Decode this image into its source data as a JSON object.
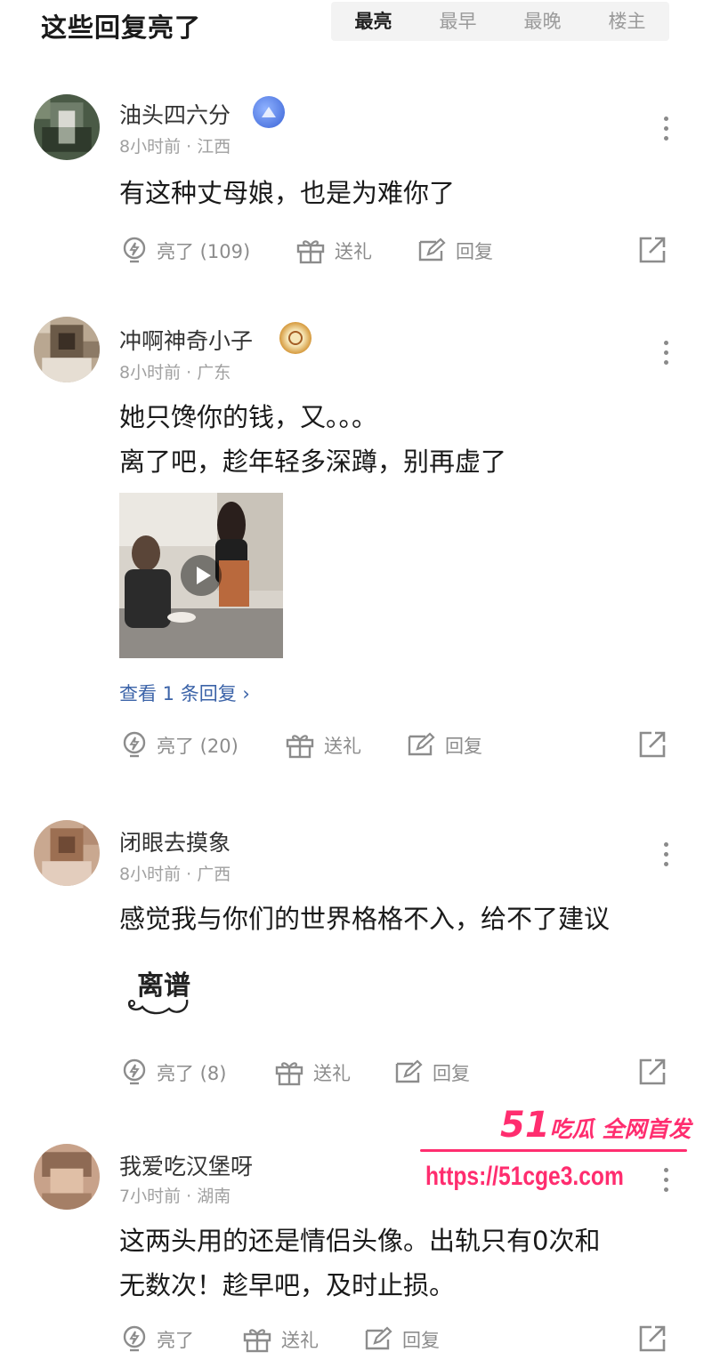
{
  "header": {
    "title": "这些回复亮了",
    "tabs": [
      {
        "label": "最亮",
        "active": true
      },
      {
        "label": "最早",
        "active": false
      },
      {
        "label": "最晚",
        "active": false
      },
      {
        "label": "楼主",
        "active": false
      }
    ]
  },
  "comments": [
    {
      "username": "油头四六分",
      "meta": "8小时前 · 江西",
      "text_lines": [
        "有这种丈母娘，也是为难你了"
      ],
      "actions": {
        "like": "亮了 (109)",
        "gift": "送礼",
        "reply": "回复"
      }
    },
    {
      "username": "冲啊神奇小子",
      "meta": "8小时前 · 广东",
      "text_lines": [
        "她只馋你的钱，又。。。",
        "离了吧，趁年轻多深蹲，别再虚了"
      ],
      "view_replies": "查看 1 条回复 ›",
      "actions": {
        "like": "亮了 (20)",
        "gift": "送礼",
        "reply": "回复"
      }
    },
    {
      "username": "闭眼去摸象",
      "meta": "8小时前 · 广西",
      "text_lines": [
        "感觉我与你们的世界格格不入，给不了建议"
      ],
      "sticker": "离谱",
      "actions": {
        "like": "亮了 (8)",
        "gift": "送礼",
        "reply": "回复"
      }
    },
    {
      "username": "我爱吃汉堡呀",
      "meta": "7小时前 · 湖南",
      "text_lines": [
        "这两头用的还是情侣头像。出轨只有0次和",
        "无数次！趁早吧，及时止损。"
      ],
      "actions": {
        "like": "亮了",
        "gift": "送礼",
        "reply": "回复"
      }
    }
  ],
  "watermark": {
    "brand_number": "51",
    "brand_text": "吃瓜 全网首发",
    "url": "https://51cge3.com"
  },
  "colors": {
    "accent_link": "#3b63a8",
    "watermark": "#ff2d6f",
    "muted": "#8c8c8c"
  }
}
